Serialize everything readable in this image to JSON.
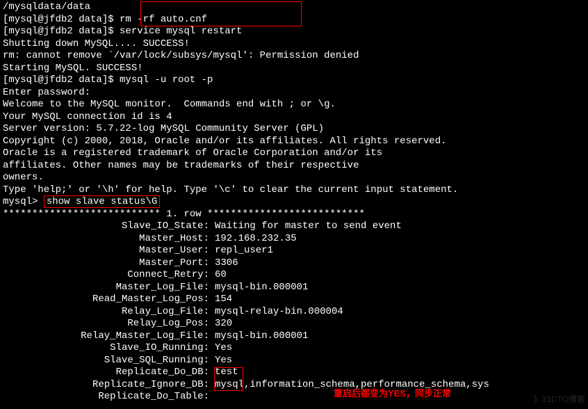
{
  "lines": {
    "l0": "/mysqldata/data",
    "l1_prompt": "[mysql@jfdb2 data]$ ",
    "l1_cmd": "rm -rf auto.cnf",
    "l2_prompt": "[mysql@jfdb2 data]$ ",
    "l2_cmd": "service mysql restart",
    "l3": "Shutting down MySQL.... SUCCESS!",
    "l4": "rm: cannot remove `/var/lock/subsys/mysql': Permission denied",
    "l5": "Starting MySQL. SUCCESS!",
    "l6": "[mysql@jfdb2 data]$ mysql -u root -p",
    "l7": "Enter password:",
    "l8": "Welcome to the MySQL monitor.  Commands end with ; or \\g.",
    "l9": "Your MySQL connection id is 4",
    "l10": "Server version: 5.7.22-log MySQL Community Server (GPL)",
    "l11": "",
    "l12": "Copyright (c) 2000, 2018, Oracle and/or its affiliates. All rights reserved.",
    "l13": "",
    "l14": "Oracle is a registered trademark of Oracle Corporation and/or its",
    "l15": "affiliates. Other names may be trademarks of their respective",
    "l16": "owners.",
    "l17": "",
    "l18": "Type 'help;' or '\\h' for help. Type '\\c' to clear the current input statement.",
    "l19": "",
    "l20_prompt": "mysql> ",
    "l20_cmd": "show slave status\\G",
    "l21": "*************************** 1. row ***************************"
  },
  "status": {
    "slave_io_state": {
      "label": "Slave_IO_State:",
      "value": "Waiting for master to send event"
    },
    "master_host": {
      "label": "Master_Host:",
      "value": "192.168.232.35"
    },
    "master_user": {
      "label": "Master_User:",
      "value": "repl_user1"
    },
    "master_port": {
      "label": "Master_Port:",
      "value": "3306"
    },
    "connect_retry": {
      "label": "Connect_Retry:",
      "value": "60"
    },
    "master_log_file": {
      "label": "Master_Log_File:",
      "value": "mysql-bin.000001"
    },
    "read_master_log_pos": {
      "label": "Read_Master_Log_Pos:",
      "value": "154"
    },
    "relay_log_file": {
      "label": "Relay_Log_File:",
      "value": "mysql-relay-bin.000004"
    },
    "relay_log_pos": {
      "label": "Relay_Log_Pos:",
      "value": "320"
    },
    "relay_master_log_file": {
      "label": "Relay_Master_Log_File:",
      "value": "mysql-bin.000001"
    },
    "slave_io_running": {
      "label": "Slave_IO_Running:",
      "value": "Yes"
    },
    "slave_sql_running": {
      "label": "Slave_SQL_Running:",
      "value": "Yes"
    },
    "replicate_do_db": {
      "label": "Replicate_Do_DB:",
      "value": "test"
    },
    "replicate_ignore_db": {
      "label": "Replicate_Ignore_DB:",
      "value": "mysql,information_schema,performance_schema,sys"
    },
    "replicate_do_table": {
      "label": "Replicate_Do_Table:",
      "value": ""
    }
  },
  "annotation": "重启后都变为YES，同步正常",
  "watermark": "》31CTO博客"
}
